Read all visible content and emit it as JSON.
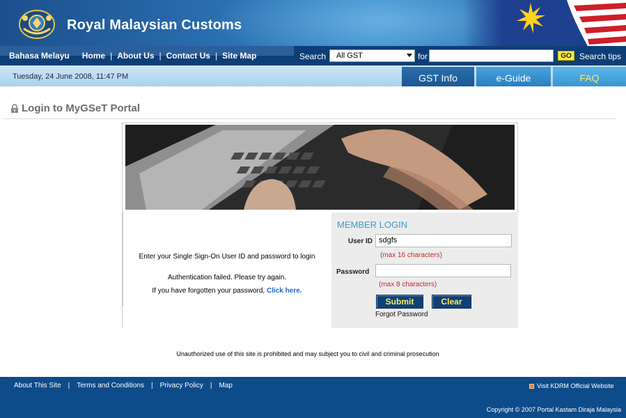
{
  "header": {
    "brand": "Royal Malaysian Customs"
  },
  "nav": {
    "language": "Bahasa Melayu",
    "links": [
      "Home",
      "About Us",
      "Contact Us",
      "Site Map"
    ],
    "search_label": "Search",
    "search_scope": "All GST",
    "for_label": "for",
    "search_value": "",
    "go_label": "GO",
    "search_tips": "Search tips"
  },
  "date": "Tuesday, 24 June 2008, 11:47 PM",
  "tabs": [
    "GST Info",
    "e-Guide",
    "FAQ"
  ],
  "page": {
    "title": "Login to MyGSeT Portal",
    "instruction": "Enter your Single Sign-On User ID and password to login",
    "error": "Authentication failed. Please try again.",
    "forgot_text": "If you have forgotten your password,",
    "forgot_link": "Click here."
  },
  "login": {
    "title": "MEMBER LOGIN",
    "user_label": "User ID",
    "user_value": "sdgfs",
    "user_hint": "(max 16 characters)",
    "password_label": "Password",
    "password_value": "",
    "password_hint": "(max 8 characters)",
    "submit_label": "Submit",
    "clear_label": "Clear",
    "forgot_label": "Forgot Password"
  },
  "disclaimer": "Unauthorized use of this site is prohibited and may subject you to civil and criminal prosecution",
  "footer": {
    "links": [
      "About This Site",
      "Terms and Conditions",
      "Privacy Policy",
      "Map"
    ],
    "kdrm": "Visit KDRM Official Website",
    "copyright": "Copyright  ©  2007 Portal Kastam Diraja Malaysia"
  },
  "colors": {
    "header_blue": "#1c4f8e",
    "nav_blue": "#0e3e77",
    "footer_blue": "#0e4b8a",
    "button_text": "#ffee55",
    "hint_red": "#c0282d",
    "link_blue": "#1f66c8"
  }
}
